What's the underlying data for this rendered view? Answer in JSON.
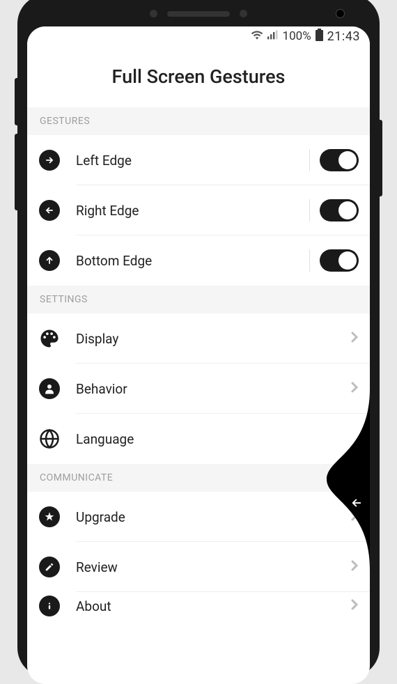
{
  "statusbar": {
    "battery_pct": "100%",
    "time": "21:43"
  },
  "app_title": "Full Screen Gestures",
  "sections": {
    "gestures": {
      "header": "GESTURES",
      "items": [
        {
          "label": "Left Edge",
          "icon": "arrow-right"
        },
        {
          "label": "Right Edge",
          "icon": "arrow-left"
        },
        {
          "label": "Bottom Edge",
          "icon": "arrow-up"
        }
      ]
    },
    "settings": {
      "header": "SETTINGS",
      "items": [
        {
          "label": "Display",
          "icon": "palette"
        },
        {
          "label": "Behavior",
          "icon": "person"
        },
        {
          "label": "Language",
          "icon": "globe"
        }
      ]
    },
    "communicate": {
      "header": "COMMUNICATE",
      "items": [
        {
          "label": "Upgrade",
          "icon": "star"
        },
        {
          "label": "Review",
          "icon": "edit"
        },
        {
          "label": "About",
          "icon": "info"
        }
      ]
    }
  }
}
